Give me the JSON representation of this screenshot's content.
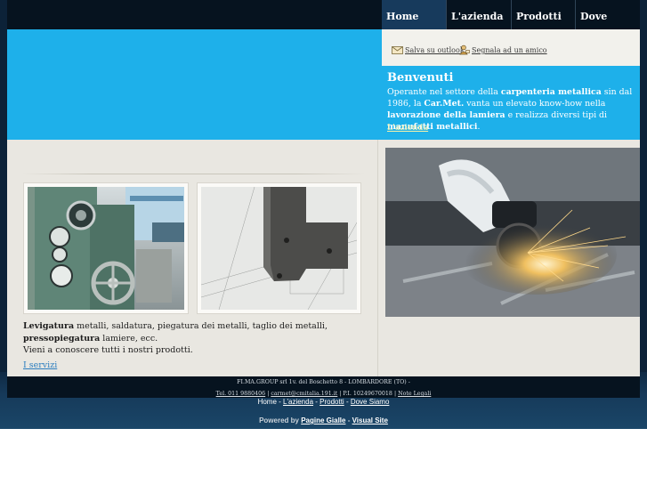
{
  "nav": {
    "items": [
      {
        "label": "Home"
      },
      {
        "label": "L'azienda"
      },
      {
        "label": "Prodotti"
      },
      {
        "label": "Dove Siamo"
      }
    ]
  },
  "utility": {
    "outlook_label": "Salva su outlook",
    "friend_label": "Segnala ad un amico"
  },
  "welcome": {
    "title": "Benvenuti",
    "text_1": "Operante nel settore della ",
    "text_bold_1": "carpenteria metallica",
    "text_2": " sin dal 1986, la ",
    "text_bold_2": "Car.Met.",
    "text_3": " vanta un elevato know-how nella ",
    "text_bold_3": "lavorazione della lamiera",
    "text_4": " e realizza diversi tipi di ",
    "text_bold_4": "manufatti metallici",
    "text_5": ".",
    "link": "L'azienda"
  },
  "main": {
    "desc_bold_1": "Levigatura",
    "desc_1": " metalli, saldatura, piegatura dei metalli, taglio dei metalli, ",
    "desc_bold_2": "pressopiegatura",
    "desc_2": " lamiere, ecc.",
    "desc_3": "Vieni a conoscere tutti i nostri prodotti.",
    "services_link": "I servizi"
  },
  "footer": {
    "line1": "FI.MA.GROUP srl 1v. del Boschetto 8 - LOMBARDORE (TO) -",
    "tel": "Tel. 011 9880406",
    "email": "carmet@cmitalia.191.it",
    "piva": "P.I. 10249670018",
    "legal": "Note Legali"
  },
  "bottom_nav": {
    "home": "Home",
    "azienda": "L'azienda",
    "prodotti": "Prodotti",
    "dove": "Dove Siamo"
  },
  "powered": {
    "prefix": "Powered by",
    "pagine": "Pagine Gialle",
    "visual": "Visual Site"
  },
  "colors": {
    "accent_blue": "#1eb0ea",
    "dark_navy": "#06131f",
    "content_bg": "#e9e7e1",
    "link_yellow": "#f6f2a8"
  }
}
